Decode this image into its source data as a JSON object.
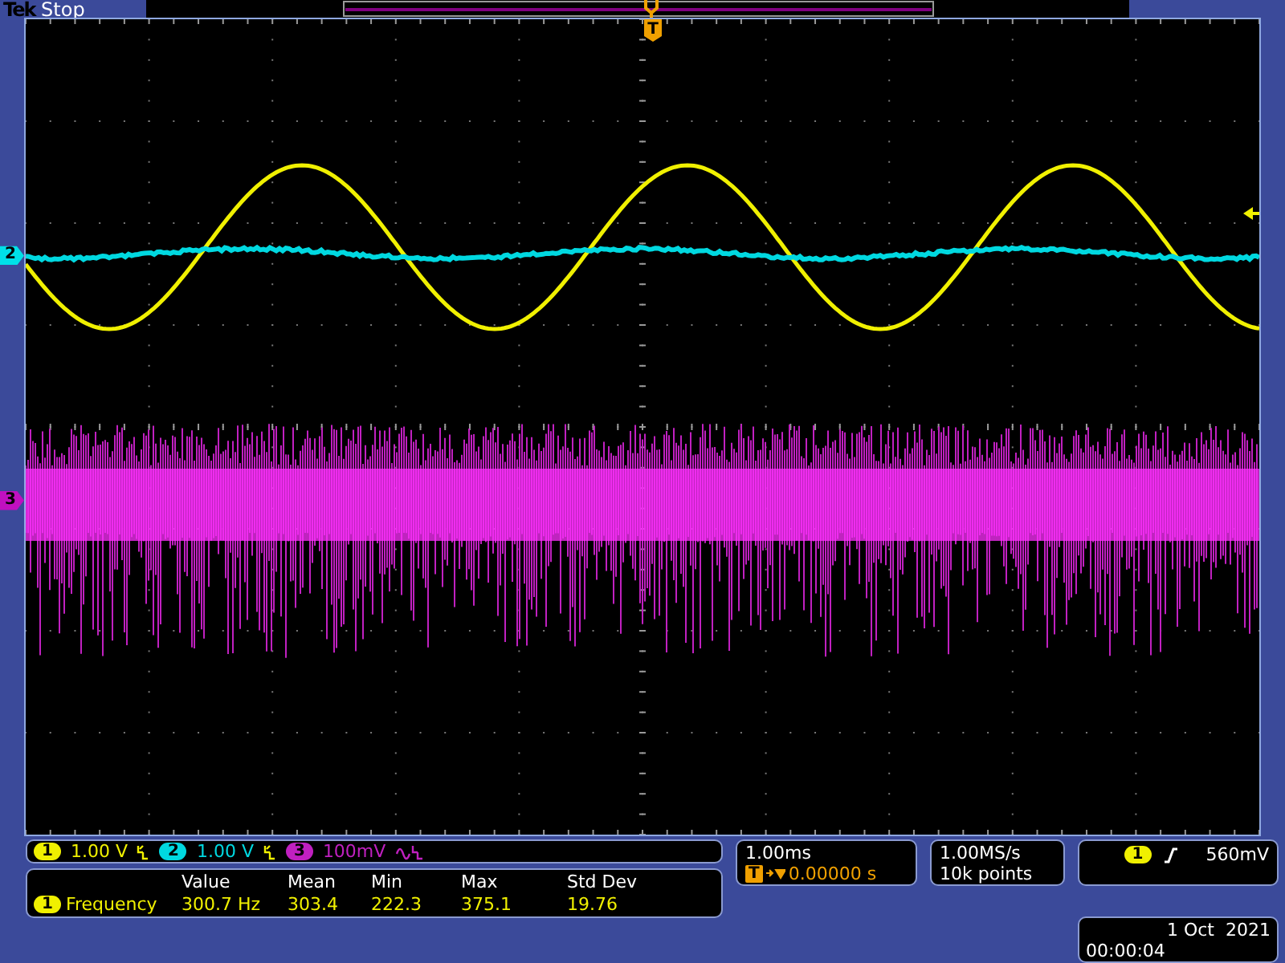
{
  "status_bar": {
    "brand": "Tek",
    "state": "Stop"
  },
  "trigger_position_marker": "T",
  "channel_markers": [
    {
      "label": "2",
      "color": "#00e0e8"
    },
    {
      "label": "3",
      "color": "#c010c0"
    }
  ],
  "channels": [
    {
      "number": "1",
      "scale": "1.00 V",
      "color": "#f0f000",
      "kind": "bw"
    },
    {
      "number": "2",
      "scale": "1.00 V",
      "color": "#00d8e0",
      "kind": "bw"
    },
    {
      "number": "3",
      "scale": "100mV",
      "color": "#c020c0",
      "kind": "acbw"
    }
  ],
  "measurements": {
    "columns": [
      "Value",
      "Mean",
      "Min",
      "Max",
      "Std Dev"
    ],
    "rows": [
      {
        "source": "1",
        "name": "Frequency",
        "values": [
          "300.7 Hz",
          "303.4",
          "222.3",
          "375.1",
          "19.76"
        ]
      }
    ]
  },
  "horizontal": {
    "scale": "1.00ms",
    "position_marker": "T",
    "delay": "0.00000 s"
  },
  "acquisition": {
    "rate": "1.00MS/s",
    "record": "10k points"
  },
  "trigger": {
    "source": "1",
    "rising_edge": true,
    "level": "560mV"
  },
  "clock": {
    "date": "1 Oct  2021",
    "time": "00:00:04"
  }
}
